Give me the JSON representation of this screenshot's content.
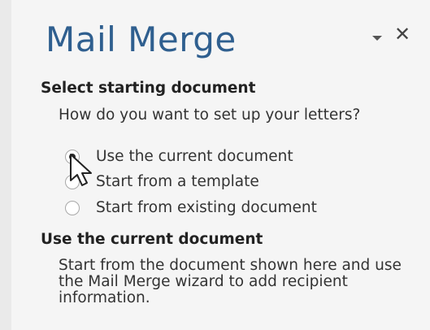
{
  "pane": {
    "title": "Mail Merge",
    "menu_icon": "dropdown-arrow-icon",
    "close_icon": "close-icon",
    "close_glyph": "✕"
  },
  "section1": {
    "heading": "Select starting document",
    "prompt": "How do you want to set up your letters?",
    "options": [
      {
        "label": "Use the current document",
        "selected": true
      },
      {
        "label": "Start from a template",
        "selected": false
      },
      {
        "label": "Start from existing document",
        "selected": false
      }
    ]
  },
  "section2": {
    "heading": "Use the current document",
    "description": "Start from the document shown here and use the Mail Merge wizard to add recipient information."
  },
  "colors": {
    "title": "#2f5f8f",
    "pane_background": "#f5f5f5"
  }
}
